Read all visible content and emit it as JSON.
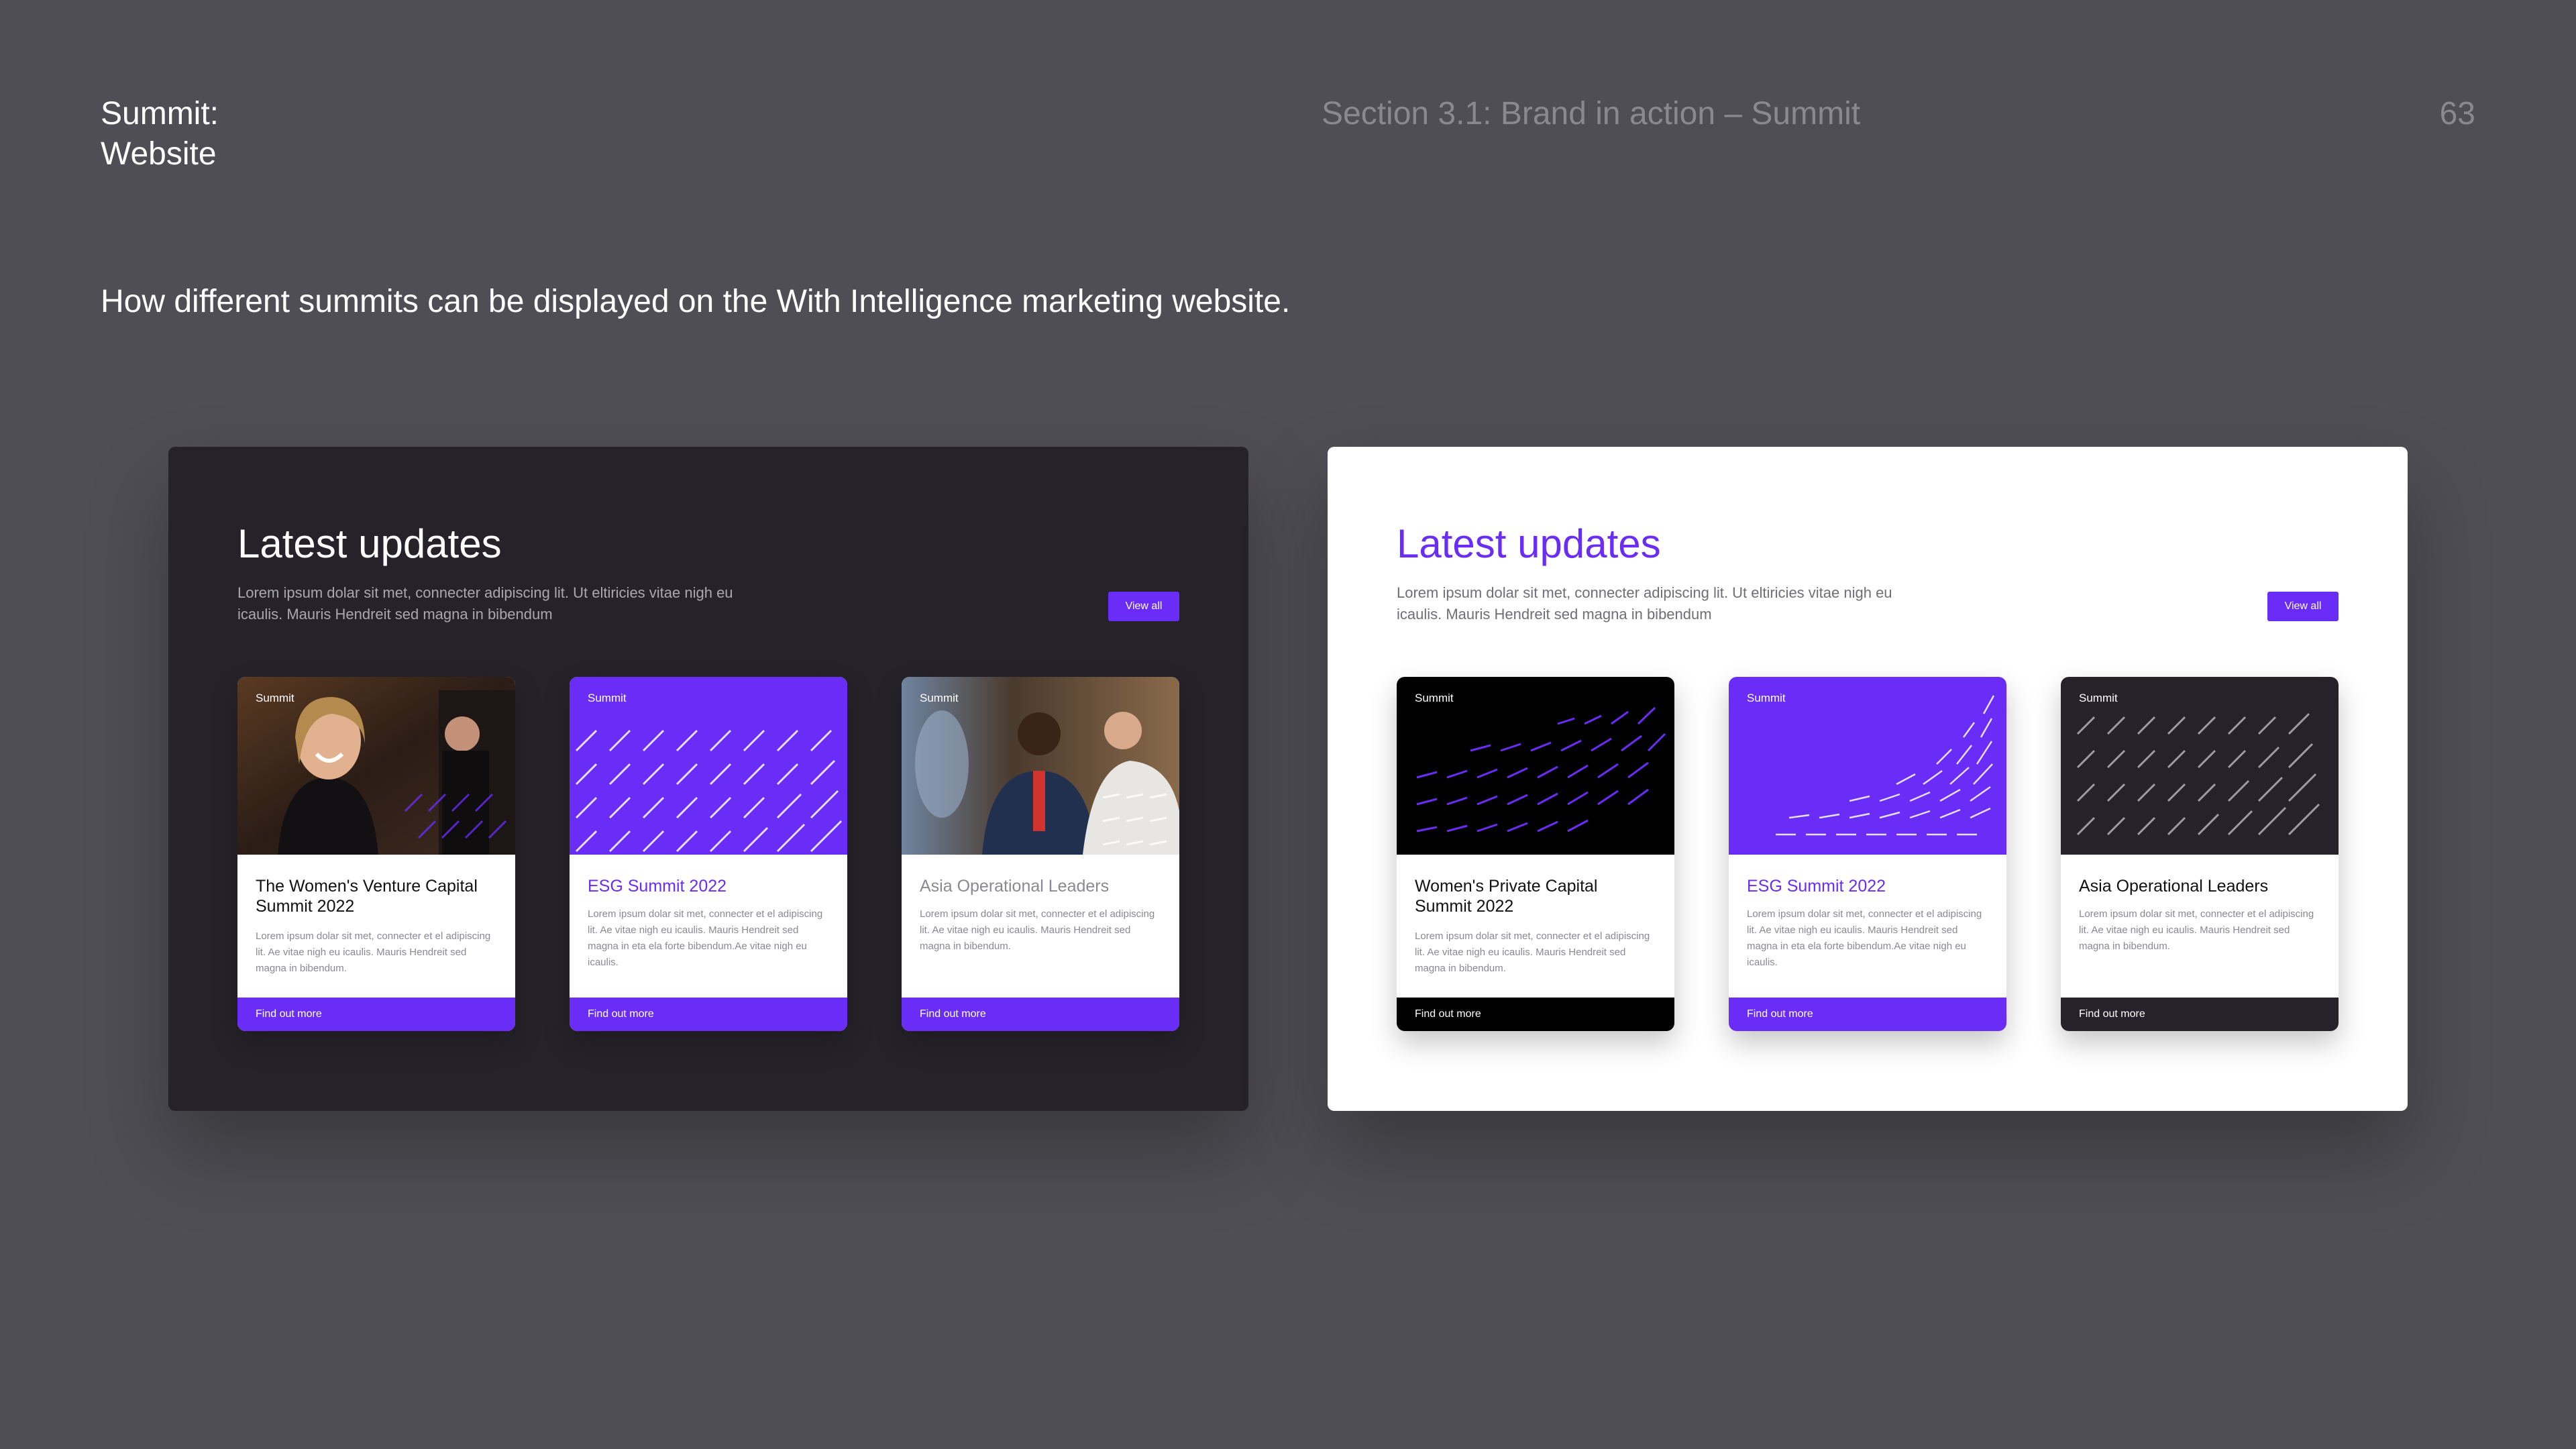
{
  "doc": {
    "title_line1": "Summit:",
    "title_line2": "Website",
    "section": "Section 3.1: Brand in action – Summit",
    "page_number": "63",
    "intro": "How different summits can be displayed on the With Intelligence marketing website."
  },
  "colors": {
    "background": "#4f4e54",
    "dark_panel": "#252329",
    "accent_purple": "#6a2cf7",
    "card_black": "#000000",
    "card_charcoal": "#252329"
  },
  "dark_panel": {
    "heading": "Latest updates",
    "subtitle": "Lorem ipsum dolar sit met, connecter adipiscing lit. Ut eltiricies vitae nigh eu icaulis. Mauris Hendreit sed magna in bibendum",
    "view_all_label": "View all",
    "cards": [
      {
        "tag": "Summit",
        "title": "The Women's Venture Capital Summit 2022",
        "body": "Lorem ipsum dolar sit met, connecter et el adipiscing lit. Ae vitae nigh eu icaulis. Mauris Hendreit sed magna in bibendum.",
        "cta": "Find out more"
      },
      {
        "tag": "Summit",
        "title": "ESG Summit 2022",
        "body": "Lorem ipsum dolar sit met, connecter et el adipiscing lit. Ae vitae nigh eu icaulis. Mauris Hendreit sed magna in eta ela forte bibendum.Ae vitae nigh eu icaulis.",
        "cta": "Find out more"
      },
      {
        "tag": "Summit",
        "title": "Asia Operational Leaders",
        "body": "Lorem ipsum dolar sit met, connecter et el adipiscing lit. Ae vitae nigh eu icaulis. Mauris Hendreit sed magna in bibendum.",
        "cta": "Find out more"
      }
    ]
  },
  "light_panel": {
    "heading": "Latest updates",
    "subtitle": "Lorem ipsum dolar sit met, connecter adipiscing lit. Ut eltiricies vitae nigh eu icaulis. Mauris Hendreit sed magna in bibendum",
    "view_all_label": "View all",
    "cards": [
      {
        "tag": "Summit",
        "title": "Women's Private Capital Summit 2022",
        "body": "Lorem ipsum dolar sit met, connecter et el adipiscing lit. Ae vitae nigh eu icaulis. Mauris Hendreit sed magna in bibendum.",
        "cta": "Find out more"
      },
      {
        "tag": "Summit",
        "title": "ESG Summit 2022",
        "body": "Lorem ipsum dolar sit met, connecter et el adipiscing lit. Ae vitae nigh eu icaulis. Mauris Hendreit sed magna in eta ela forte bibendum.Ae vitae nigh eu icaulis.",
        "cta": "Find out more"
      },
      {
        "tag": "Summit",
        "title": "Asia Operational Leaders",
        "body": "Lorem ipsum dolar sit met, connecter et el adipiscing lit. Ae vitae nigh eu icaulis. Mauris Hendreit sed magna in bibendum.",
        "cta": "Find out more"
      }
    ]
  }
}
